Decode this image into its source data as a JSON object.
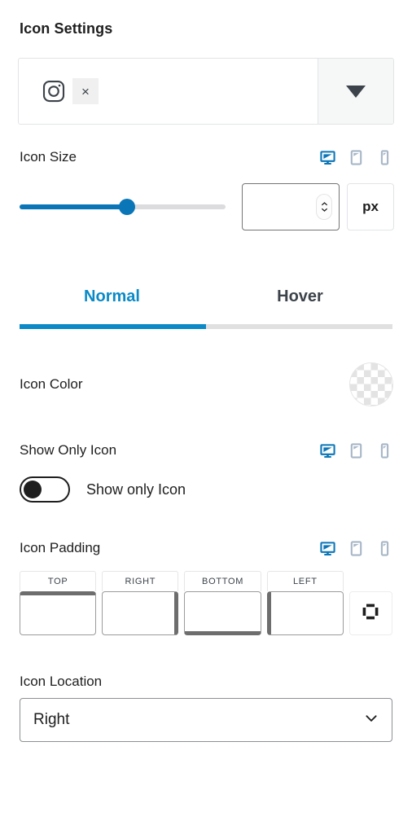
{
  "section": {
    "title": "Icon Settings"
  },
  "icon_picker": {
    "selected_icon": "instagram-icon",
    "clear_label": "×",
    "toggle_icon": "caret-down-icon"
  },
  "icon_size": {
    "label": "Icon Size",
    "devices": [
      {
        "name": "desktop",
        "icon": "desktop-icon",
        "active": true
      },
      {
        "name": "tablet",
        "icon": "tablet-icon",
        "active": false
      },
      {
        "name": "mobile",
        "icon": "mobile-icon",
        "active": false
      }
    ],
    "slider_percent": 52,
    "value": "",
    "placeholder": "",
    "unit": "px"
  },
  "tabs": [
    {
      "label": "Normal",
      "active": true
    },
    {
      "label": "Hover",
      "active": false
    }
  ],
  "icon_color": {
    "label": "Icon Color",
    "value": "",
    "swatch": "transparent-checkerboard"
  },
  "show_only_icon": {
    "label": "Show Only Icon",
    "devices": [
      {
        "name": "desktop",
        "icon": "desktop-icon",
        "active": true
      },
      {
        "name": "tablet",
        "icon": "tablet-icon",
        "active": false
      },
      {
        "name": "mobile",
        "icon": "mobile-icon",
        "active": false
      }
    ],
    "toggle_label": "Show only Icon",
    "toggle_on": false
  },
  "icon_padding": {
    "label": "Icon Padding",
    "devices": [
      {
        "name": "desktop",
        "icon": "desktop-icon",
        "active": true
      },
      {
        "name": "tablet",
        "icon": "tablet-icon",
        "active": false
      },
      {
        "name": "mobile",
        "icon": "mobile-icon",
        "active": false
      }
    ],
    "fields": [
      {
        "caption": "TOP",
        "value": "",
        "placeholder": ""
      },
      {
        "caption": "RIGHT",
        "value": "",
        "placeholder": ""
      },
      {
        "caption": "BOTTOM",
        "value": "",
        "placeholder": ""
      },
      {
        "caption": "LEFT",
        "value": "",
        "placeholder": ""
      }
    ],
    "link_icon": "link-dimensions-icon"
  },
  "icon_location": {
    "label": "Icon Location",
    "selected": "Right",
    "chevron": "chevron-down-icon"
  },
  "colors": {
    "accent": "#0b8ac7",
    "slider": "#0b76b7",
    "text": "#1e1e1e",
    "muted": "#3c434a",
    "device_inactive": "#a7b6c7",
    "track": "#dcdcde"
  }
}
